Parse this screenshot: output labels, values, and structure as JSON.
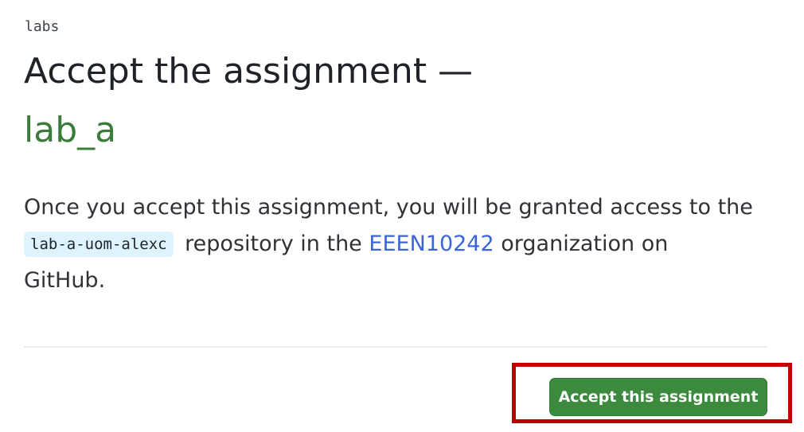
{
  "breadcrumb": {
    "classroom": "labs"
  },
  "header": {
    "title": "Accept the assignment —",
    "assignment_name": "lab_a"
  },
  "description": {
    "line_prefix": "Once you accept this assignment, you will be granted access to the ",
    "repo_name": "lab-a-uom-alexc",
    "middle_text": " repository in the ",
    "org_name": "EEEN10242",
    "suffix": " organization on GitHub."
  },
  "actions": {
    "accept_label": "Accept this assignment"
  },
  "colors": {
    "accent_green": "#3b8a3e",
    "link_blue": "#3b65d9",
    "highlight_red": "#c00000"
  }
}
